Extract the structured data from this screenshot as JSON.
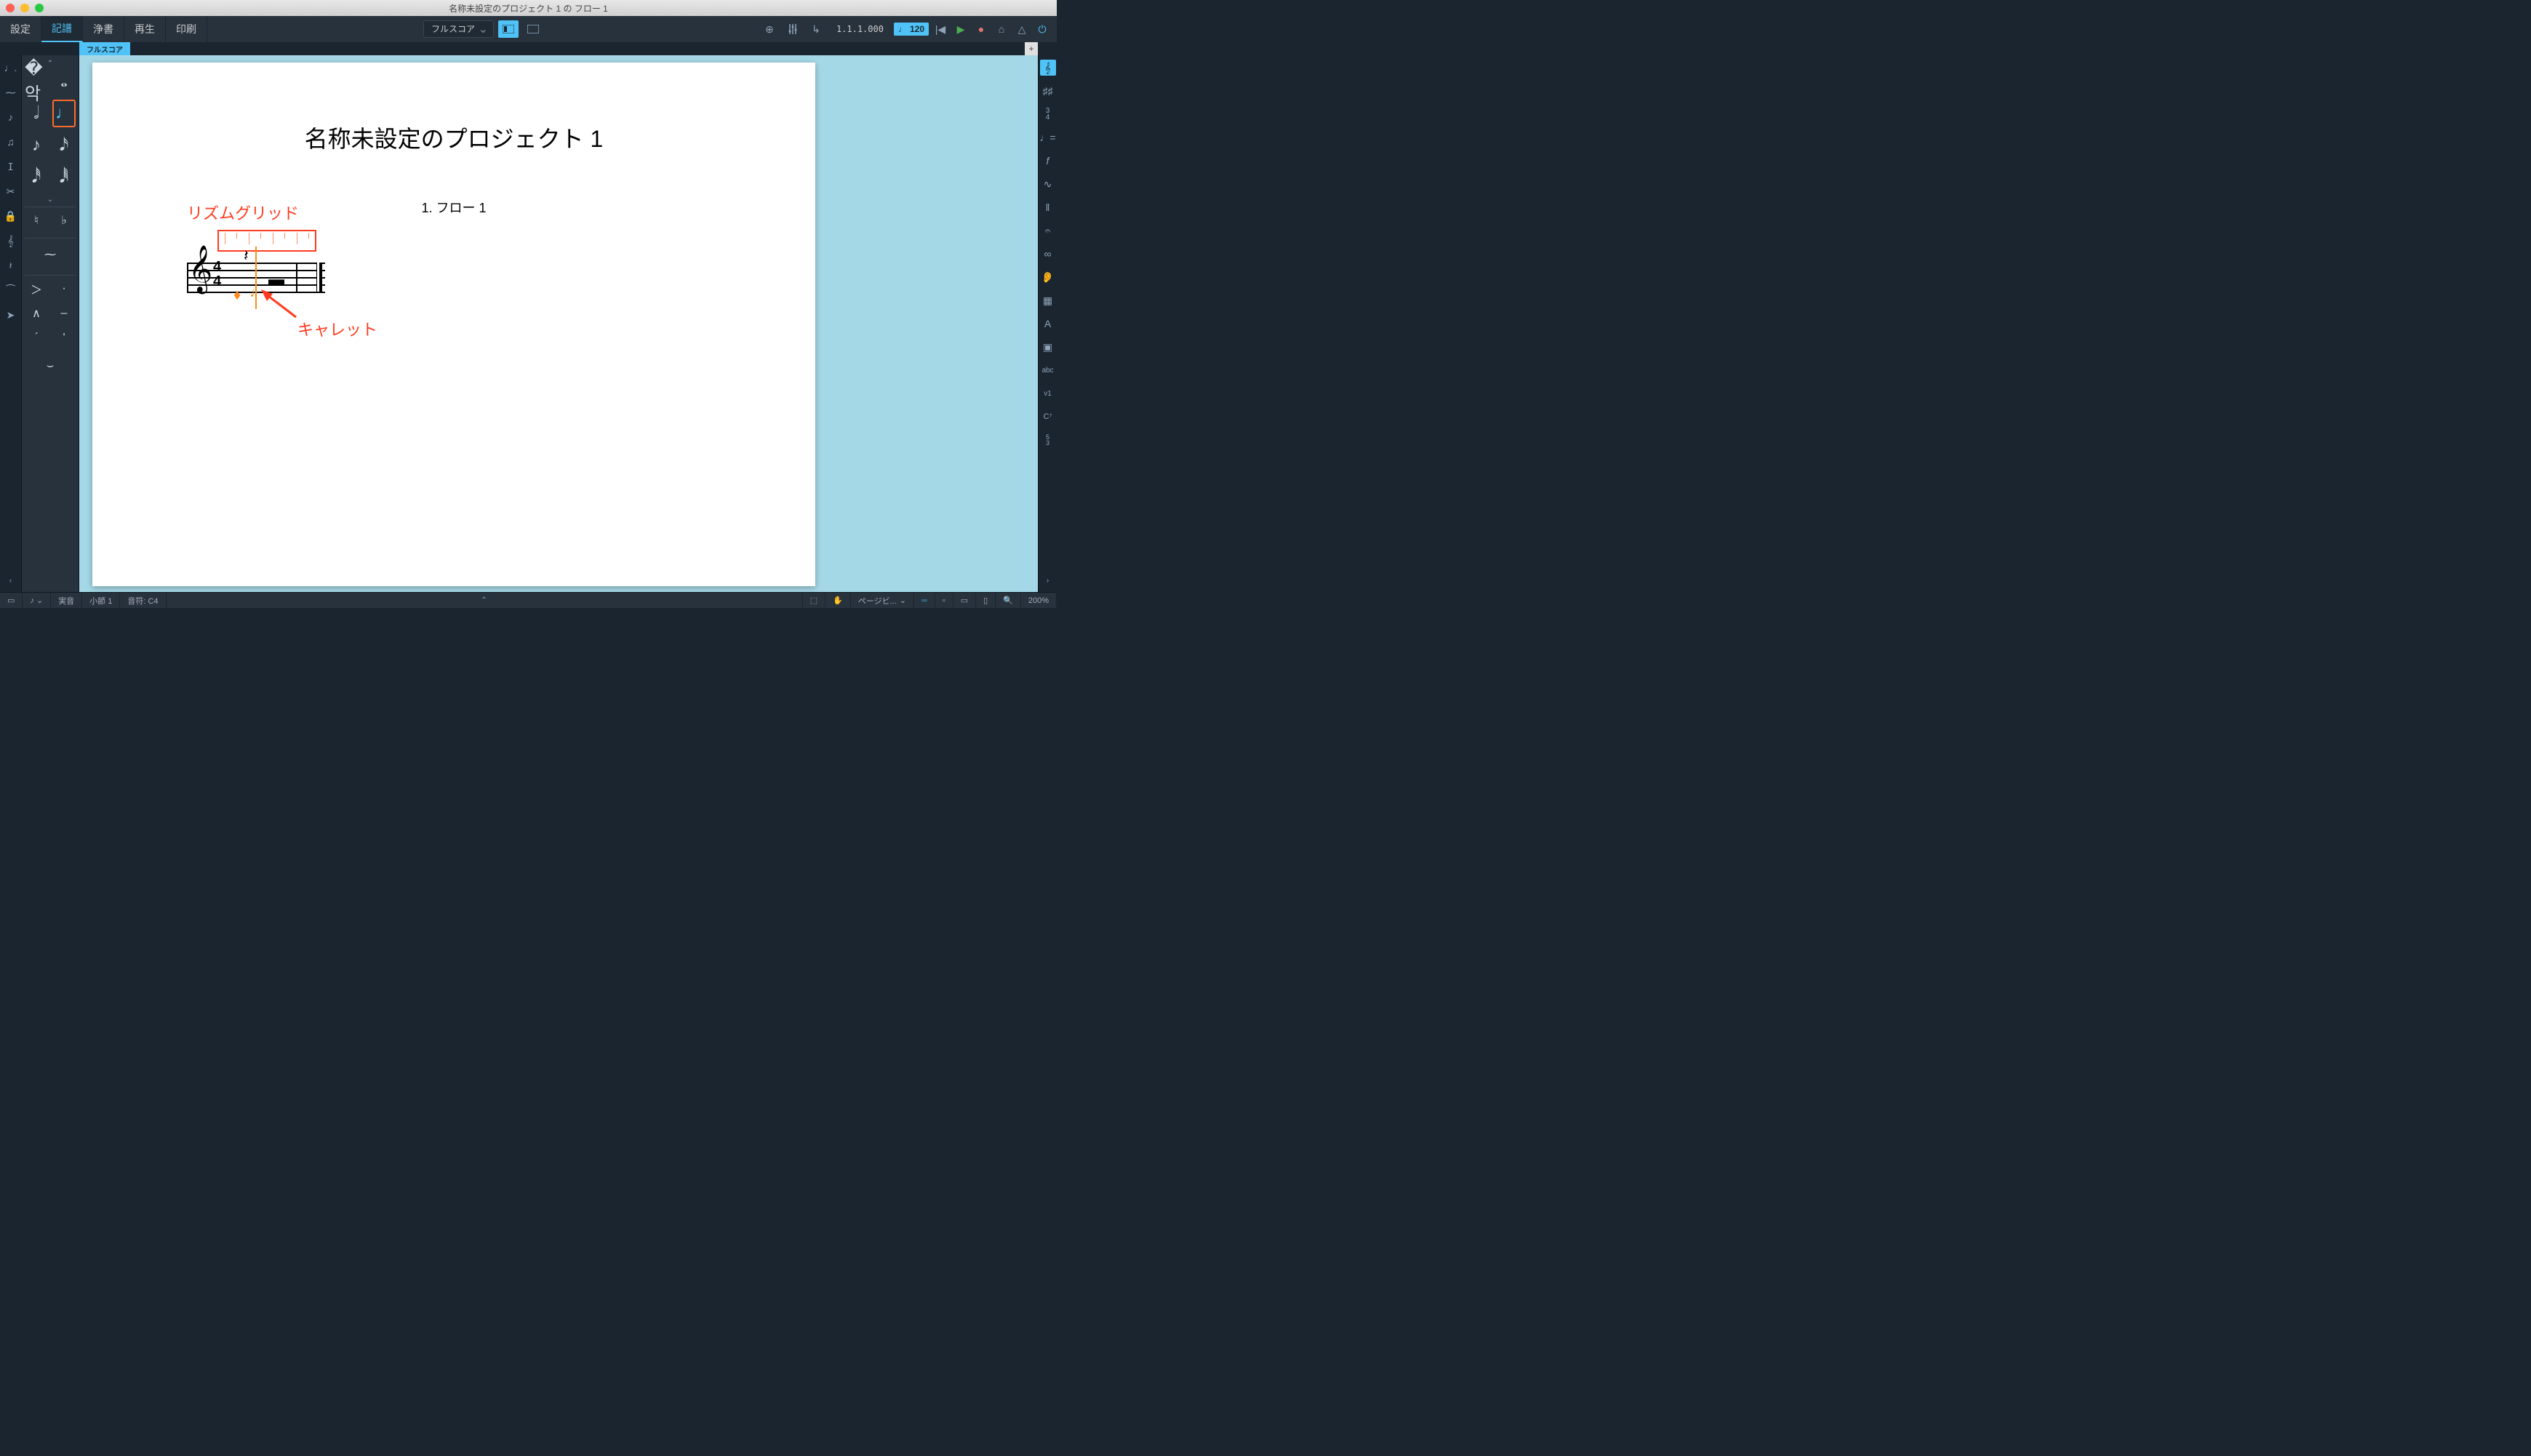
{
  "window": {
    "title": "名称未設定のプロジェクト 1 の フロー 1"
  },
  "modes": {
    "setup": "設定",
    "write": "記譜",
    "engrave": "浄書",
    "play": "再生",
    "print": "印刷"
  },
  "toolbar": {
    "layout_selector": "フルスコア",
    "transport_position": "1.1.1.000",
    "tempo_value": "120"
  },
  "layout_tab": {
    "label": "フルスコア",
    "add": "+"
  },
  "left_notation_icons": [
    "dotted-note-icon",
    "tuplet-icon",
    "grace-note-icon",
    "chord-icon",
    "tie-icon",
    "slash-icon",
    "lock-icon",
    "clef-icon",
    "rest-icon",
    "scissors-icon",
    "arrow-icon"
  ],
  "note_durations": {
    "chevron_up": "⌃",
    "chevron_down": "⌄",
    "row1": [
      "breve-note",
      "whole-note"
    ],
    "row2": [
      "half-note",
      "quarter-note"
    ],
    "row3": [
      "eighth-note",
      "sixteenth-note"
    ],
    "row4": [
      "thirtysecond-note",
      "sixtyfourth-note"
    ],
    "accidentals": [
      "natural",
      "flat",
      "sharp"
    ],
    "articulations": [
      "accent",
      "staccato",
      "marcato",
      "tenuto",
      "staccatissimo-up",
      "staccatissimo-down",
      "breath",
      "fermata"
    ]
  },
  "right_panel_icons": [
    "clef-panel-icon",
    "key-signature-icon",
    "time-signature-icon",
    "tempo-panel-icon",
    "dynamics-icon",
    "ornaments-icon",
    "bars-panel-icon",
    "repeats-icon",
    "holds-icon",
    "playing-techniques-icon",
    "lines-icon",
    "text-icon",
    "lyrics-icon",
    "chord-symbols-icon",
    "figured-bass-icon"
  ],
  "score": {
    "project_title": "名称未設定のプロジェクト 1",
    "flow_heading": "1. フロー 1"
  },
  "annotations": {
    "rhythm_grid": "リズムグリッド",
    "caret": "キャレット"
  },
  "status": {
    "mode": "実音",
    "bar": "小節 1",
    "note": "音符: C4",
    "view_menu": "ページビ...",
    "zoom": "200%"
  }
}
